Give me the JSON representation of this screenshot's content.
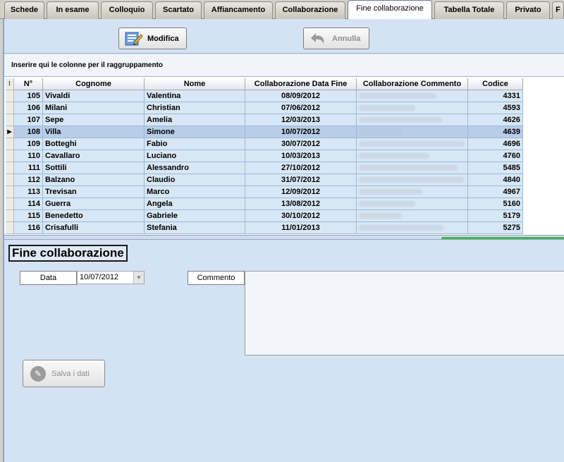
{
  "tabs": [
    {
      "label": "Schede",
      "active": false
    },
    {
      "label": "In esame",
      "active": false
    },
    {
      "label": "Colloquio",
      "active": false
    },
    {
      "label": "Scartato",
      "active": false
    },
    {
      "label": "Affiancamento",
      "active": false
    },
    {
      "label": "Collaborazione",
      "active": false
    },
    {
      "label": "Fine collaborazione",
      "active": true
    },
    {
      "label": "Tabella Totale",
      "active": false
    },
    {
      "label": "Privato",
      "active": false
    },
    {
      "label": "F",
      "active": false
    }
  ],
  "toolbar": {
    "modify_label": "Modifica",
    "undo_label": "Annulla"
  },
  "grouping": {
    "hint": "Inserire qui le colonne per il raggruppamento"
  },
  "grid": {
    "columns": [
      "N°",
      "Cognome",
      "Nome",
      "Collaborazione Data Fine",
      "Collaborazione Commento",
      "Codice"
    ],
    "rows": [
      {
        "n": "105",
        "cognome": "Vivaldi",
        "nome": "Valentina",
        "data": "08/09/2012",
        "codice": "4331"
      },
      {
        "n": "106",
        "cognome": "Milani",
        "nome": "Christian",
        "data": "07/06/2012",
        "codice": "4593"
      },
      {
        "n": "107",
        "cognome": "Sepe",
        "nome": "Amelia",
        "data": "12/03/2013",
        "codice": "4626"
      },
      {
        "n": "108",
        "cognome": "Villa",
        "nome": "Simone",
        "data": "10/07/2012",
        "codice": "4639"
      },
      {
        "n": "109",
        "cognome": "Botteghi",
        "nome": "Fabio",
        "data": "30/07/2012",
        "codice": "4696"
      },
      {
        "n": "110",
        "cognome": "Cavallaro",
        "nome": "Luciano",
        "data": "10/03/2013",
        "codice": "4760"
      },
      {
        "n": "111",
        "cognome": "Sottili",
        "nome": "Alessandro",
        "data": "27/10/2012",
        "codice": "5485"
      },
      {
        "n": "112",
        "cognome": "Balzano",
        "nome": "Claudio",
        "data": "31/07/2012",
        "codice": "4840"
      },
      {
        "n": "113",
        "cognome": "Trevisan",
        "nome": "Marco",
        "data": "12/09/2012",
        "codice": "4967"
      },
      {
        "n": "114",
        "cognome": "Guerra",
        "nome": "Angela",
        "data": "13/08/2012",
        "codice": "5160"
      },
      {
        "n": "115",
        "cognome": "Benedetto",
        "nome": "Gabriele",
        "data": "30/10/2012",
        "codice": "5179"
      },
      {
        "n": "116",
        "cognome": "Crisafulli",
        "nome": "Stefania",
        "data": "11/01/2013",
        "codice": "5275"
      }
    ],
    "selected_row": 3
  },
  "panel": {
    "title": "Fine collaborazione",
    "date_label": "Data",
    "date_value": "10/07/2012",
    "comment_label": "Commento",
    "save_label": "Salva i dati"
  },
  "icons": {
    "modify": "edit-document-icon",
    "undo": "undo-arrow-icon",
    "save": "save-pen-icon",
    "dropdown": "chevron-down-icon",
    "row_indicator": "current-row-arrow-icon",
    "column_chooser": "column-chooser-icon"
  }
}
